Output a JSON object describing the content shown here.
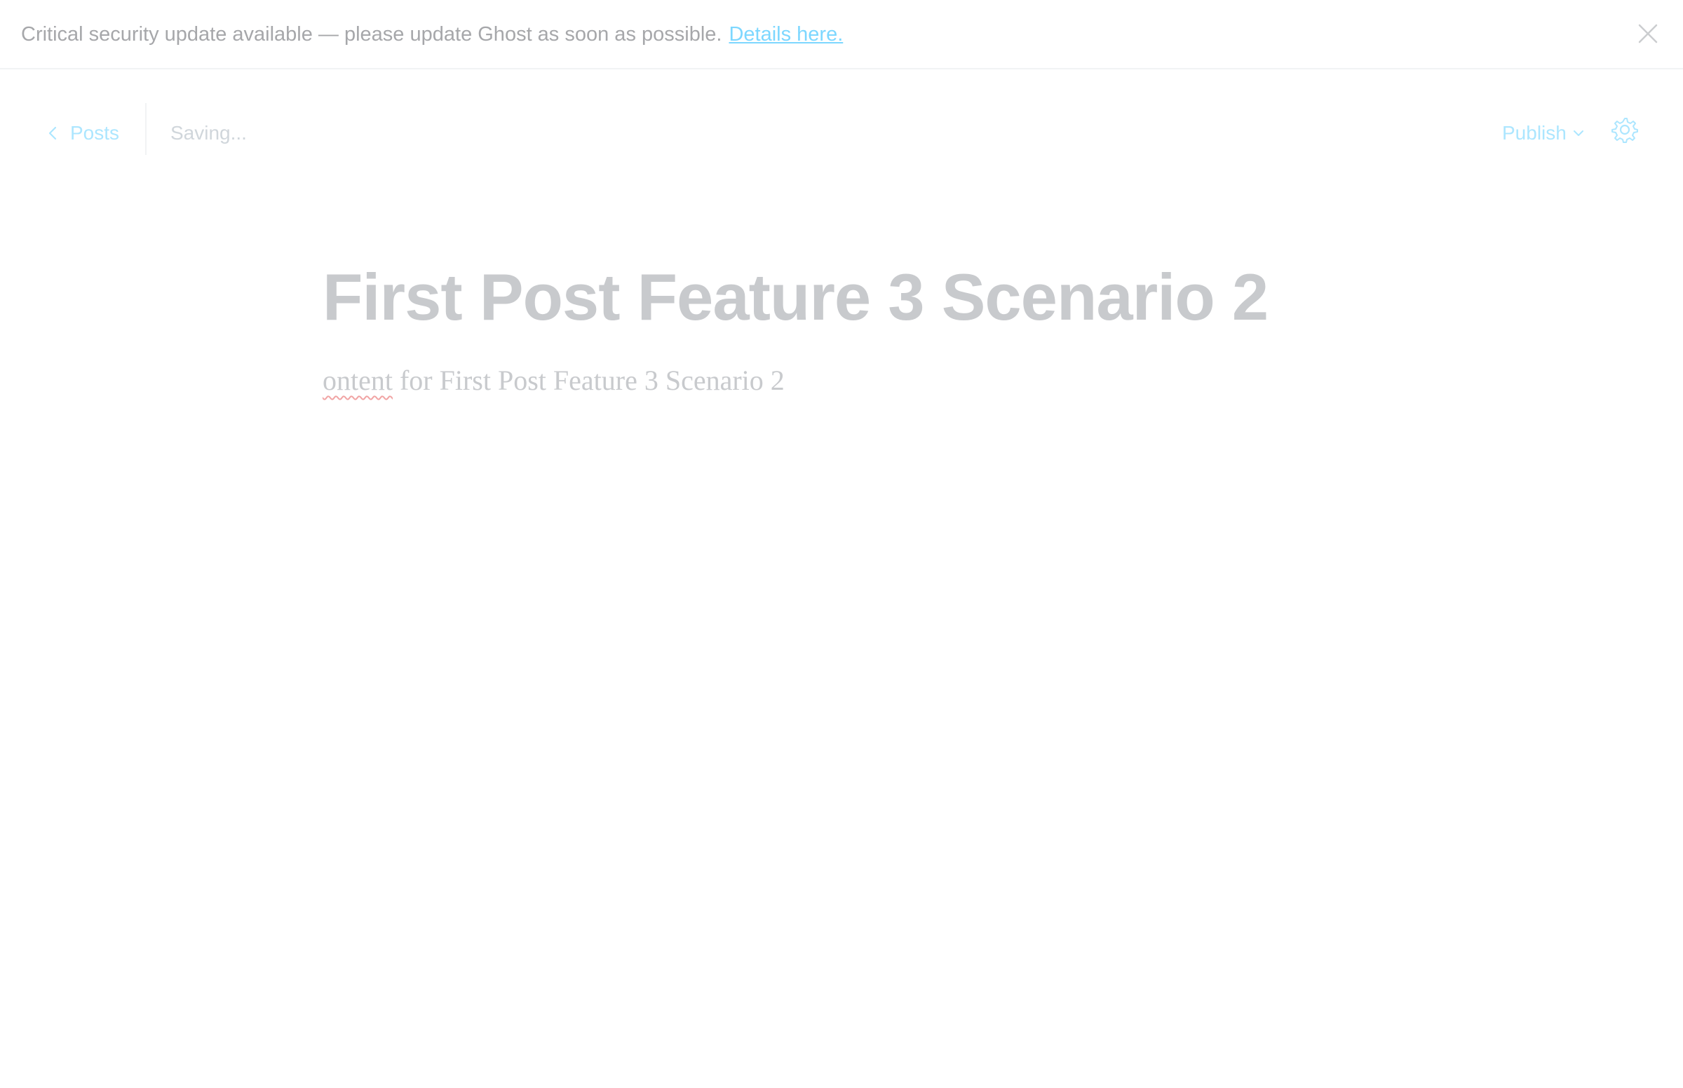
{
  "banner": {
    "message": "Critical security update available — please update Ghost as soon as possible.",
    "link_label": "Details here.",
    "close_icon": "close-icon"
  },
  "header": {
    "back_label": "Posts",
    "back_icon": "chevron-left-icon",
    "status": "Saving...",
    "publish_label": "Publish",
    "publish_icon": "chevron-down-icon",
    "settings_icon": "gear-icon"
  },
  "editor": {
    "title": "First Post Feature 3 Scenario 2",
    "body_misspelled_word": "ontent",
    "body_rest": " for First Post Feature 3 Scenario 2"
  },
  "colors": {
    "accent": "#14b8ff",
    "muted_text": "#c8cacd",
    "spellcheck_underline": "#f1a4a4"
  }
}
